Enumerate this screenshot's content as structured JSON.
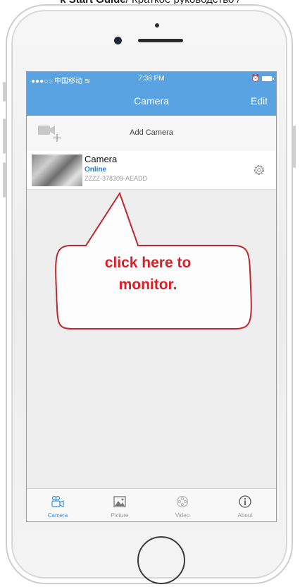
{
  "caption": {
    "bold": "k Start Guide",
    "rest": "/ Краткое руководство / "
  },
  "status_bar": {
    "carrier": "●●●○○ 中国移动 ",
    "time": "7:38 PM"
  },
  "nav": {
    "title": "Camera",
    "edit": "Edit"
  },
  "add_camera": {
    "label": "Add Camera"
  },
  "camera": {
    "name": "Camera",
    "status": "Online",
    "uid": "ZZZZ-378309-AEADD"
  },
  "callout": {
    "line1": "click here to",
    "line2": "monitor."
  },
  "tabs": [
    {
      "label": "Camera",
      "icon": "camera-icon",
      "active": true
    },
    {
      "label": "Picture",
      "icon": "picture-icon",
      "active": false
    },
    {
      "label": "Video",
      "icon": "video-reel-icon",
      "active": false
    },
    {
      "label": "About",
      "icon": "info-icon",
      "active": false
    }
  ],
  "colors": {
    "accent": "#59a3e3",
    "callout_red": "#e11b23",
    "online_blue": "#2f79c8"
  }
}
